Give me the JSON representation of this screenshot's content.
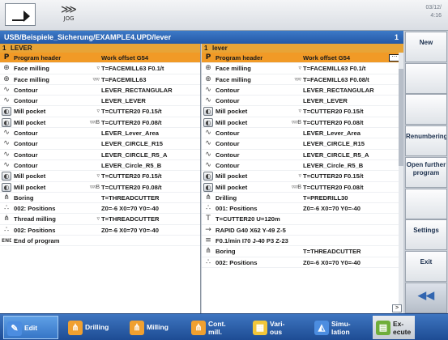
{
  "header": {
    "mode_icon": "auto-mode-icon",
    "jog_label": "JOG",
    "clock_line1": "03/12/",
    "clock_line2": "4:16"
  },
  "path": {
    "title": "USB/Beispiele_Sicherung/EXAMPLE4.UPD/lever",
    "channel": "1"
  },
  "left_pane": {
    "num": "1",
    "title": "LEVER",
    "rows": [
      {
        "icon": "P",
        "name": "Program header",
        "mark": "",
        "value": "Work offset G54",
        "selected": true
      },
      {
        "icon": "⊕",
        "name": "Face milling",
        "mark": "▿",
        "value": "T=FACEMILL63 F0.1/t"
      },
      {
        "icon": "⊕",
        "name": "Face milling",
        "mark": "▿▿▿",
        "value": "T=FACEMILL63"
      },
      {
        "icon": "∿",
        "name": "Contour",
        "mark": "",
        "value": "LEVER_RECTANGULAR"
      },
      {
        "icon": "∿",
        "name": "Contour",
        "mark": "",
        "value": "LEVER_LEVER"
      },
      {
        "icon": "◐",
        "name": "Mill pocket",
        "mark": "▿",
        "value": "T=CUTTER20 F0.15/t",
        "box": true
      },
      {
        "icon": "◐",
        "name": "Mill pocket",
        "mark": "▿▿▿B",
        "value": "T=CUTTER20 F0.08/t",
        "box": true
      },
      {
        "icon": "∿",
        "name": "Contour",
        "mark": "",
        "value": "LEVER_Lever_Area"
      },
      {
        "icon": "∿",
        "name": "Contour",
        "mark": "",
        "value": "LEVER_CIRCLE_R15"
      },
      {
        "icon": "∿",
        "name": "Contour",
        "mark": "",
        "value": "LEVER_CIRCLE_R5_A"
      },
      {
        "icon": "∿",
        "name": "Contour",
        "mark": "",
        "value": "LEVER_Circle_R5_B"
      },
      {
        "icon": "◐",
        "name": "Mill pocket",
        "mark": "▿",
        "value": "T=CUTTER20 F0.15/t",
        "box": true
      },
      {
        "icon": "◐",
        "name": "Mill pocket",
        "mark": "▿▿▿B",
        "value": "T=CUTTER20 F0.08/t",
        "box": true
      },
      {
        "icon": "⋔",
        "name": "Boring",
        "mark": "",
        "value": "T=THREADCUTTER"
      },
      {
        "icon": "∴",
        "name": "002: Positions",
        "mark": "",
        "value": "Z0=-6 X0=70 Y0=-40"
      },
      {
        "icon": "⋔",
        "name": "Thread milling",
        "mark": "▿",
        "value": "T=THREADCUTTER"
      },
      {
        "icon": "∴",
        "name": "002: Positions",
        "mark": "",
        "value": "Z0=-6 X0=70 Y0=-40"
      },
      {
        "icon": "END",
        "name": "End of program",
        "mark": "",
        "value": ""
      }
    ]
  },
  "right_pane": {
    "num": "1",
    "title": "lever",
    "rows": [
      {
        "icon": "P",
        "name": "Program header",
        "mark": "",
        "value": "Work offset G54",
        "selected": true
      },
      {
        "icon": "⊕",
        "name": "Face milling",
        "mark": "▿",
        "value": "T=FACEMILL63 F0.1/t"
      },
      {
        "icon": "⊕",
        "name": "Face milling",
        "mark": "▿▿▿",
        "value": "T=FACEMILL63 F0.08/t"
      },
      {
        "icon": "∿",
        "name": "Contour",
        "mark": "",
        "value": "LEVER_RECTANGULAR"
      },
      {
        "icon": "∿",
        "name": "Contour",
        "mark": "",
        "value": "LEVER_LEVER"
      },
      {
        "icon": "◐",
        "name": "Mill pocket",
        "mark": "▿",
        "value": "T=CUTTER20 F0.15/t",
        "box": true
      },
      {
        "icon": "◐",
        "name": "Mill pocket",
        "mark": "▿▿▿B",
        "value": "T=CUTTER20 F0.08/t",
        "box": true
      },
      {
        "icon": "∿",
        "name": "Contour",
        "mark": "",
        "value": "LEVER_Lever_Area"
      },
      {
        "icon": "∿",
        "name": "Contour",
        "mark": "",
        "value": "LEVER_CIRCLE_R15"
      },
      {
        "icon": "∿",
        "name": "Contour",
        "mark": "",
        "value": "LEVER_CIRCLE_R5_A"
      },
      {
        "icon": "∿",
        "name": "Contour",
        "mark": "",
        "value": "LEVER_Circle_R5_B"
      },
      {
        "icon": "◐",
        "name": "Mill pocket",
        "mark": "▿",
        "value": "T=CUTTER20 F0.15/t",
        "box": true
      },
      {
        "icon": "◐",
        "name": "Mill pocket",
        "mark": "▿▿▿B",
        "value": "T=CUTTER20 F0.08/t",
        "box": true
      },
      {
        "icon": "⋔",
        "name": "Drilling",
        "mark": "",
        "value": "T=PREDRILL30"
      },
      {
        "icon": "∴",
        "name": "001: Positions",
        "mark": "",
        "value": "Z0=-6 X0=70 Y0=-40"
      },
      {
        "icon": "T",
        "name": "T=CUTTER20 U=120m",
        "mark": "",
        "value": ""
      },
      {
        "icon": "→",
        "name": "RAPID G40 X62 Y-49 Z-5",
        "mark": "",
        "value": ""
      },
      {
        "icon": "≡",
        "name": "F0.1/min I70 J-40 P3 Z-23",
        "mark": "",
        "value": ""
      },
      {
        "icon": "⋔",
        "name": "Boring",
        "mark": "",
        "value": "T=THREADCUTTER"
      },
      {
        "icon": "∴",
        "name": "002: Positions",
        "mark": "",
        "value": "Z0=-6 X0=70 Y0=-40"
      }
    ]
  },
  "softkeys": [
    {
      "label": "New",
      "name": "softkey-new"
    },
    {
      "label": "",
      "name": "softkey-empty-2"
    },
    {
      "label": "",
      "name": "softkey-empty-3"
    },
    {
      "label": "Renumbering",
      "name": "softkey-renumbering"
    },
    {
      "label": "Open further\nprogram",
      "name": "softkey-open-further-program"
    },
    {
      "label": "",
      "name": "softkey-empty-6"
    },
    {
      "label": "Settings",
      "name": "softkey-settings"
    },
    {
      "label": "Exit",
      "name": "softkey-exit"
    },
    {
      "label": "◀◀",
      "name": "softkey-back"
    }
  ],
  "bottom_keys": [
    {
      "label": "Edit",
      "icon": "✎",
      "name": "tab-edit",
      "active": true
    },
    {
      "label": "Drilling",
      "icon": "⋔",
      "name": "tab-drilling"
    },
    {
      "label": "Milling",
      "icon": "⋔",
      "name": "tab-milling"
    },
    {
      "label": "Cont.\nmill.",
      "icon": "⋔",
      "name": "tab-contour-milling"
    },
    {
      "label": "Vari-\nous",
      "icon": "▦",
      "name": "tab-various"
    },
    {
      "label": "Simu-\nlation",
      "icon": "◭",
      "name": "tab-simulation"
    },
    {
      "label": "Ex-\necute",
      "icon": "▤",
      "name": "tab-execute",
      "plain": true
    }
  ],
  "colors": {
    "header_blue": "#2458a6",
    "selection_orange": "#f19a26",
    "pane_title_orange": "#e8a436"
  }
}
